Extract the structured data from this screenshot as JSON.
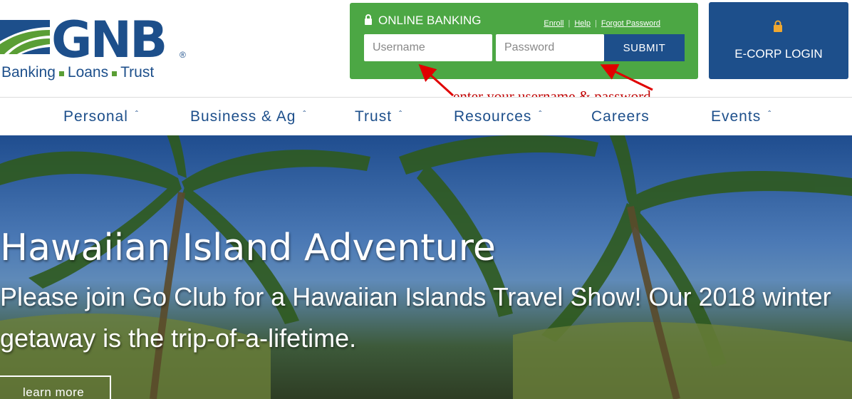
{
  "brand": {
    "name": "GNB",
    "tagline_parts": [
      "Banking",
      "Loans",
      "Trust"
    ],
    "registered_mark": "®",
    "colors": {
      "navy": "#1d4f8b",
      "green": "#4ca744"
    }
  },
  "online_banking": {
    "title": "ONLINE BANKING",
    "links": [
      "Enroll",
      "Help",
      "Forgot Password"
    ],
    "username_placeholder": "Username",
    "password_placeholder": "Password",
    "submit_label": "SUBMIT"
  },
  "ecorp": {
    "label": "E-CORP LOGIN"
  },
  "annotation": "enter your username & password",
  "nav": {
    "items": [
      {
        "label": "Personal",
        "has_dropdown": true
      },
      {
        "label": "Business & Ag",
        "has_dropdown": true
      },
      {
        "label": "Trust",
        "has_dropdown": true
      },
      {
        "label": "Resources",
        "has_dropdown": true
      },
      {
        "label": "Careers",
        "has_dropdown": false
      },
      {
        "label": "Events",
        "has_dropdown": true
      }
    ]
  },
  "hero": {
    "title": "Hawaiian Island Adventure",
    "subtitle": "Please join Go Club for a Hawaiian Islands Travel Show! Our 2018 winter getaway is the trip-of-a-lifetime.",
    "cta_label": "learn more"
  }
}
